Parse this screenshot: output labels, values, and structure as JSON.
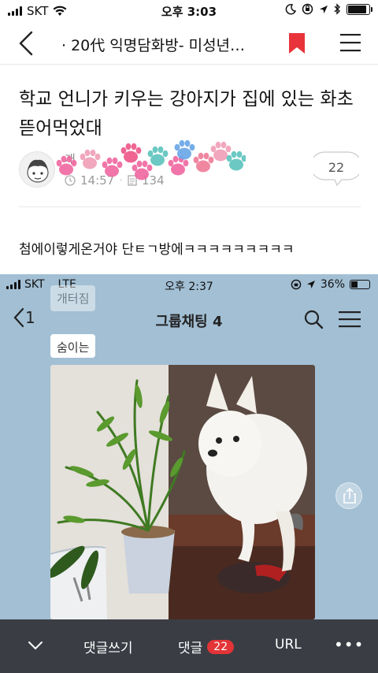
{
  "status_bar": {
    "carrier": "SKT",
    "time": "오후 3:03"
  },
  "nav": {
    "title": "· 20代 익명담화방- 미성년…"
  },
  "post": {
    "title": "학교 언니가 키우는 강아지가 집에 있는 화초 뜯어먹었대",
    "author": "개",
    "time": "14:57",
    "views": "134",
    "comment_count": "22",
    "body": "첨에이렇게온거야 단ㅌㄱ방에ㅋㅋㅋㅋㅋㅋㅋㅋㅋ"
  },
  "embedded": {
    "status_bar": {
      "carrier": "SKT",
      "network": "LTE",
      "time": "오후 2:37",
      "battery": "36%"
    },
    "chat": {
      "back_count": "1",
      "title": "그룹채팅 4",
      "messages": [
        "개터짐",
        "숨이는"
      ]
    }
  },
  "bottom_bar": {
    "write_label": "댓글쓰기",
    "comment_label": "댓글",
    "comment_count": "22",
    "url_label": "URL",
    "more_label": "•••"
  },
  "colors": {
    "bookmark": "#e8333a",
    "badge": "#e33437",
    "bottom_bar": "#3a3e44",
    "chat_bg": "#a2bfd4"
  },
  "icons": [
    "back-chevron-icon",
    "bookmark-icon",
    "menu-icon",
    "comment-icon",
    "document-icon",
    "search-icon",
    "share-icon",
    "chevron-down-icon"
  ]
}
